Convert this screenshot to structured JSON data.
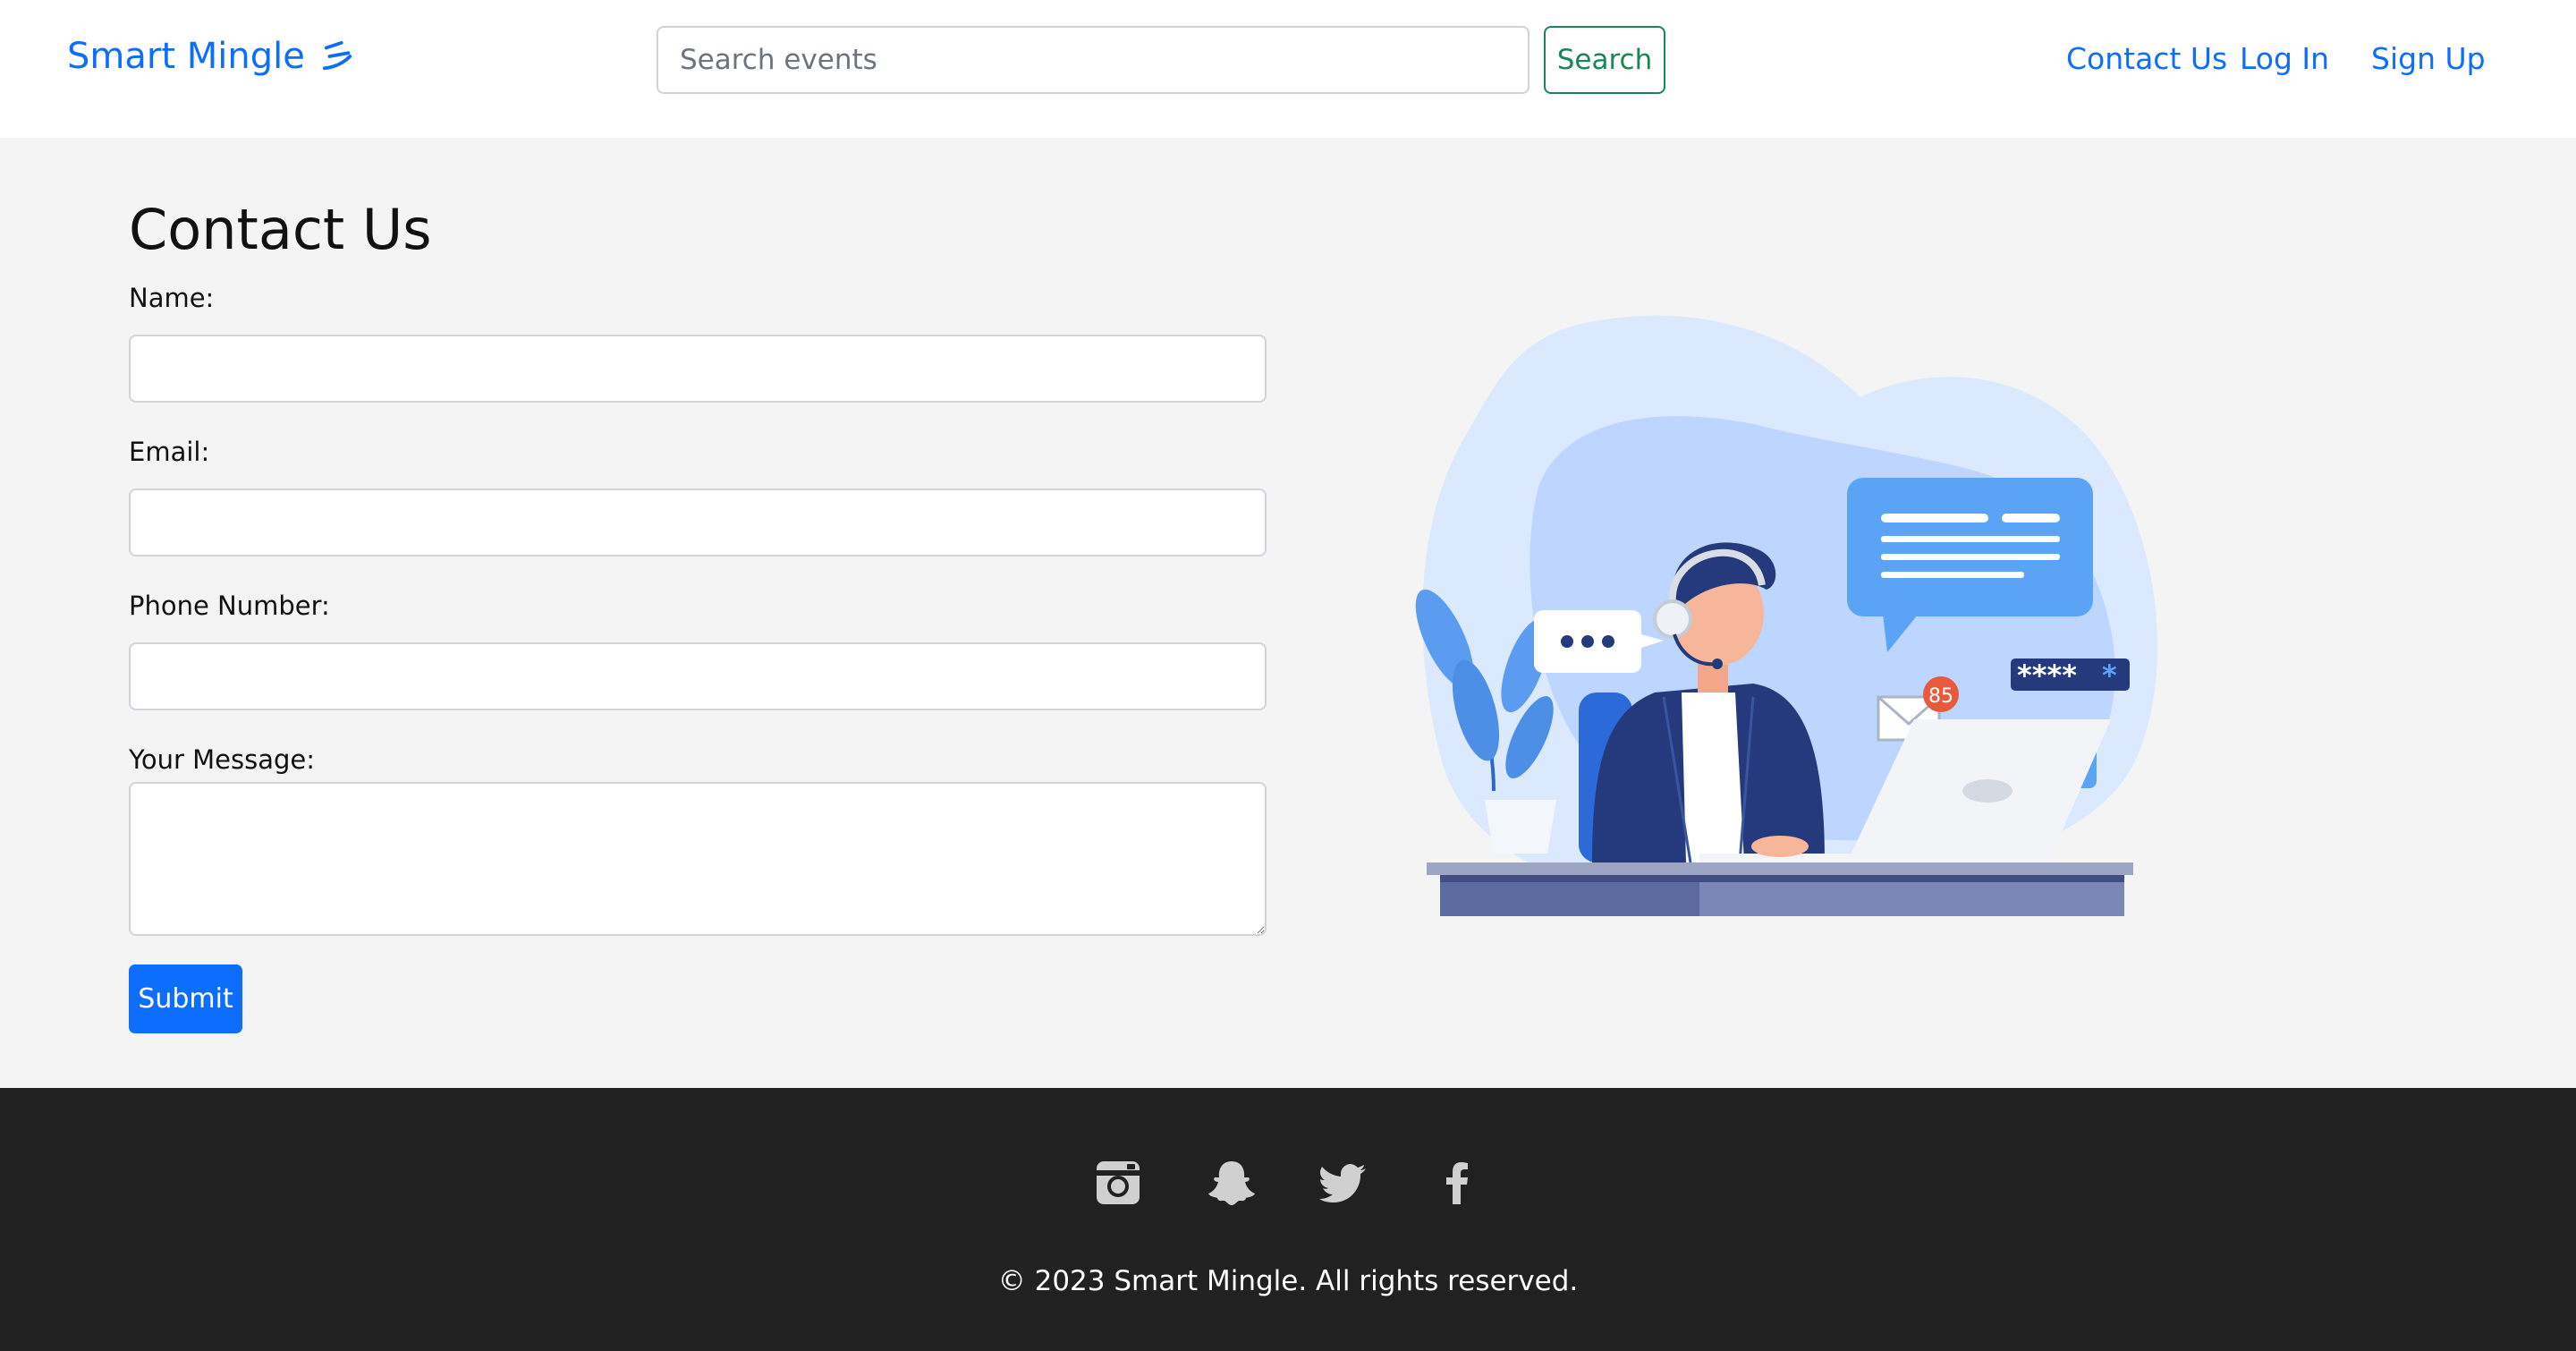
{
  "header": {
    "brand": "Smart Mingle",
    "search": {
      "placeholder": "Search events",
      "value": "",
      "button_label": "Search"
    },
    "nav": {
      "contact": "Contact Us",
      "login": "Log In",
      "signup": "Sign Up"
    }
  },
  "main": {
    "title": "Contact Us",
    "form": {
      "name_label": "Name:",
      "email_label": "Email:",
      "phone_label": "Phone Number:",
      "message_label": "Your Message:",
      "name_value": "",
      "email_value": "",
      "phone_value": "",
      "message_value": "",
      "submit_label": "Submit"
    },
    "illustration": {
      "badge_count": "85",
      "password_mask": "****"
    }
  },
  "footer": {
    "social_icons": [
      "instagram-icon",
      "snapchat-icon",
      "twitter-icon",
      "facebook-icon"
    ],
    "copyright": "© 2023 Smart Mingle. All rights reserved."
  },
  "colors": {
    "brand": "#0d6efd",
    "search_button": "#198754",
    "submit_button": "#0d6efd",
    "footer_bg": "#212121",
    "page_bg": "#f4f4f4"
  }
}
